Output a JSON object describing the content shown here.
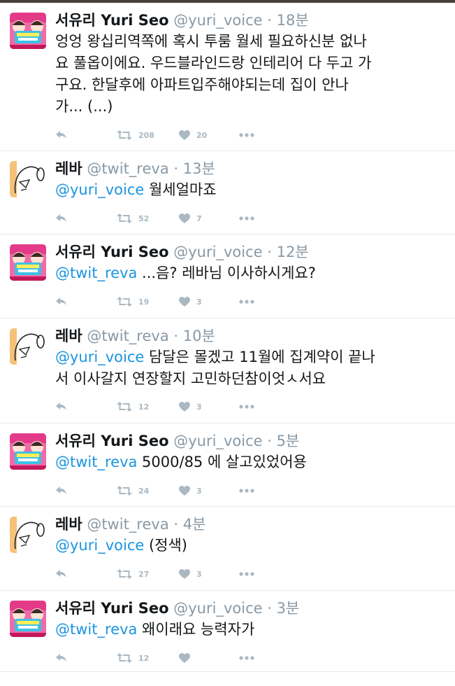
{
  "tweets": [
    {
      "name": "서유리 Yuri Seo",
      "handle": "@yuri_voice",
      "sep": "·",
      "time": "18분",
      "mention": "",
      "text": "엉엉 왕십리역쪽에 혹시 투룸 월세 필요하신분 없나\n요 풀옵이에요. 우드블라인드랑 인테리어 다 두고 가\n구요. 한달후에 아파트입주해야되는데 집이 안나\n가... (...)",
      "retweets": "208",
      "likes": "20",
      "avatar": "yuri"
    },
    {
      "name": "레바",
      "handle": "@twit_reva",
      "sep": "·",
      "time": "13분",
      "mention": "@yuri_voice",
      "text": " 월세얼마죠",
      "retweets": "52",
      "likes": "7",
      "avatar": "reva"
    },
    {
      "name": "서유리 Yuri Seo",
      "handle": "@yuri_voice",
      "sep": "·",
      "time": "12분",
      "mention": "@twit_reva",
      "text": " ...음? 레바님 이사하시게요?",
      "retweets": "19",
      "likes": "3",
      "avatar": "yuri"
    },
    {
      "name": "레바",
      "handle": "@twit_reva",
      "sep": "·",
      "time": "10분",
      "mention": "@yuri_voice",
      "text": " 담달은 몰겠고 11월에 집계약이 끝나\n서 이사갈지 연장할지 고민하던참이엇ㅅ서요",
      "retweets": "12",
      "likes": "3",
      "avatar": "reva"
    },
    {
      "name": "서유리 Yuri Seo",
      "handle": "@yuri_voice",
      "sep": "·",
      "time": "5분",
      "mention": "@twit_reva",
      "text": " 5000/85 에 살고있었어용",
      "retweets": "24",
      "likes": "3",
      "avatar": "yuri"
    },
    {
      "name": "레바",
      "handle": "@twit_reva",
      "sep": "·",
      "time": "4분",
      "mention": "@yuri_voice",
      "text": " (정색)",
      "retweets": "27",
      "likes": "3",
      "avatar": "reva"
    },
    {
      "name": "서유리 Yuri Seo",
      "handle": "@yuri_voice",
      "sep": "·",
      "time": "3분",
      "mention": "@twit_reva",
      "text": " 왜이래요 능력자가",
      "retweets": "12",
      "likes": "",
      "avatar": "yuri"
    }
  ],
  "icons": {
    "reply": "reply-icon",
    "retweet": "retweet-icon",
    "like": "heart-icon",
    "more": "more-icon"
  },
  "colors": {
    "name": "#14171a",
    "muted": "#8899a6",
    "link": "#1b95e0",
    "action": "#aab8c2",
    "divider": "#e6ecf0"
  }
}
